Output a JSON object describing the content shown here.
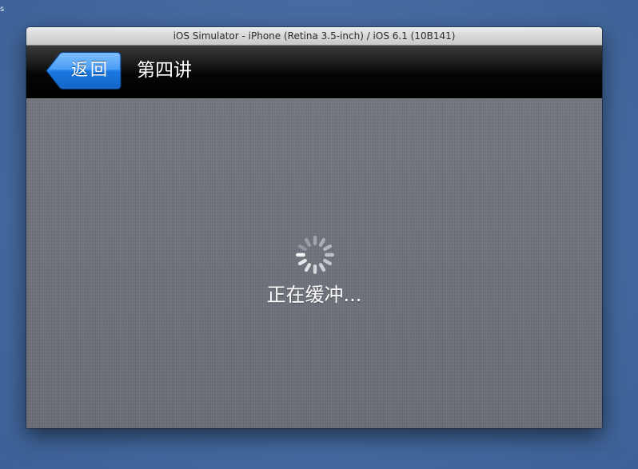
{
  "window": {
    "title": "iOS Simulator - iPhone (Retina 3.5-inch) / iOS 6.1 (10B141)"
  },
  "nav": {
    "back_label": "返回",
    "title": "第四讲"
  },
  "content": {
    "loading_text": "正在缓冲..."
  },
  "colors": {
    "desktop": "#4a6fa6",
    "nav_bar": "#000000",
    "back_button": "#1c7fe0",
    "content_bg": "#6e717a",
    "text": "#ffffff"
  },
  "icons": {
    "spinner": "activity-indicator-icon",
    "back": "back-chevron-button"
  }
}
